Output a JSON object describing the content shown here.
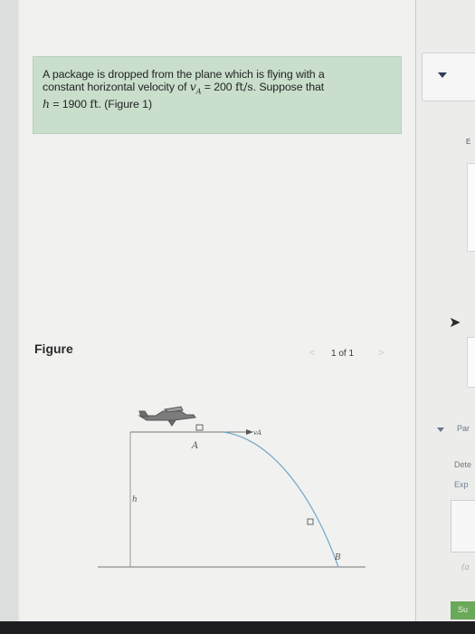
{
  "problem": {
    "line1": "A package is dropped from the plane which is flying with a",
    "line2_pre": "constant horizontal velocity of ",
    "v_symbol": "v",
    "v_sub": "A",
    "v_eq": " = 200 ",
    "v_unit": "ft/s",
    "line2_post": ". Suppose that",
    "h_symbol": "h",
    "h_eq": " = 1900 ",
    "h_unit": "ft",
    "line3_post": ". (Figure 1)"
  },
  "figure": {
    "label": "Figure",
    "pager": {
      "prev": "<",
      "count": "1 of 1",
      "next": ">"
    },
    "labels": {
      "A": "A",
      "B": "B",
      "h": "h",
      "vA": "vA"
    }
  },
  "right_panel": {
    "part": "Par",
    "determine": "Dete",
    "express": "Exp",
    "answer_hint": "(a",
    "submit": "Su",
    "edge_letter": "E"
  },
  "colors": {
    "problem_bg": "#c9dfcc",
    "trajectory": "#6fa7c7",
    "submit": "#6aa85a"
  }
}
